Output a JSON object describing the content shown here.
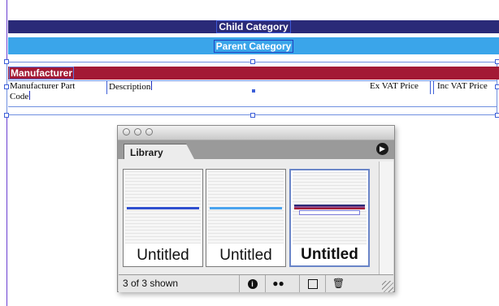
{
  "document": {
    "child_category": "Child Category",
    "parent_category": "Parent Category",
    "manufacturer": "Manufacturer",
    "columns": [
      {
        "label_line1": "Manufacturer Part",
        "label_line2": "Code"
      },
      {
        "label_line1": "Description",
        "label_line2": ""
      },
      {
        "label_line1": "Ex VAT Price",
        "label_line2": ""
      },
      {
        "label_line1": "Inc VAT Price",
        "label_line2": ""
      }
    ]
  },
  "palette": {
    "tab_label": "Library",
    "items": [
      {
        "name": "Untitled",
        "line_color": "#2f4fcf"
      },
      {
        "name": "Untitled",
        "line_color": "#4aa3ee"
      },
      {
        "name": "Untitled",
        "line_color": "#8a4a8a"
      }
    ],
    "status_text": "3 of 3 shown",
    "icons": [
      "info-icon",
      "binoculars-icon",
      "new-item-icon",
      "trash-icon",
      "resize-grip-icon"
    ]
  },
  "colors": {
    "child_band": "#2a2a78",
    "parent_band": "#3aa5ea",
    "manufacturer_band": "#a31a35",
    "selection": "#3d5fd8"
  }
}
